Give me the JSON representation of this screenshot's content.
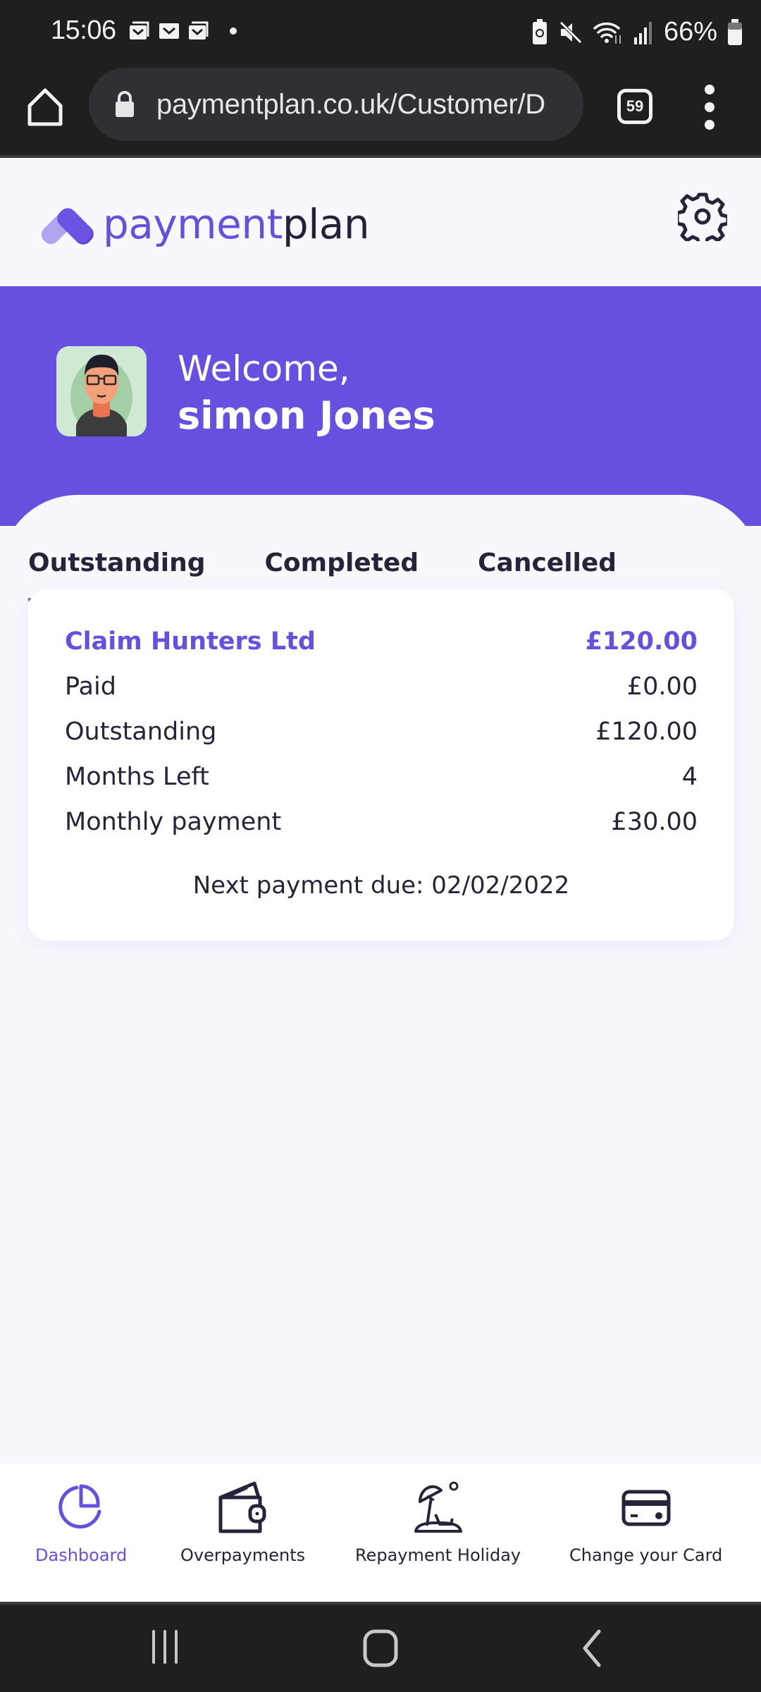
{
  "status_bar": {
    "time": "15:06",
    "notification_icons": [
      "email-icon",
      "email-icon",
      "email-icon",
      "dot-icon"
    ],
    "system_icons": [
      "battery-saver-icon",
      "mute-icon",
      "wifi-icon",
      "signal-icon"
    ],
    "battery": "66%"
  },
  "browser": {
    "url": "paymentplan.co.uk/Customer/D",
    "tab_count": "59"
  },
  "app": {
    "logo_part1": "payment",
    "logo_part2": "plan"
  },
  "welcome": {
    "greeting": "Welcome,",
    "name": "simon Jones"
  },
  "tabs": [
    {
      "label": "Outstanding",
      "active": true
    },
    {
      "label": "Completed",
      "active": false
    },
    {
      "label": "Cancelled",
      "active": false
    }
  ],
  "plan": {
    "company": "Claim Hunters Ltd",
    "total": "£120.00",
    "rows": [
      {
        "label": "Paid",
        "value": "£0.00"
      },
      {
        "label": "Outstanding",
        "value": "£120.00"
      },
      {
        "label": "Months Left",
        "value": "4"
      },
      {
        "label": "Monthly payment",
        "value": "£30.00"
      }
    ],
    "next_due": "Next payment due: 02/02/2022"
  },
  "bottom_nav": [
    {
      "label": "Dashboard",
      "icon": "pie-chart-icon",
      "active": true
    },
    {
      "label": "Overpayments",
      "icon": "wallet-icon",
      "active": false
    },
    {
      "label": "Repayment Holiday",
      "icon": "beach-umbrella-icon",
      "active": false
    },
    {
      "label": "Change your Card",
      "icon": "credit-card-icon",
      "active": false
    }
  ],
  "colors": {
    "brand": "#6750de",
    "text": "#25243a",
    "background": "#f7f8fc"
  }
}
